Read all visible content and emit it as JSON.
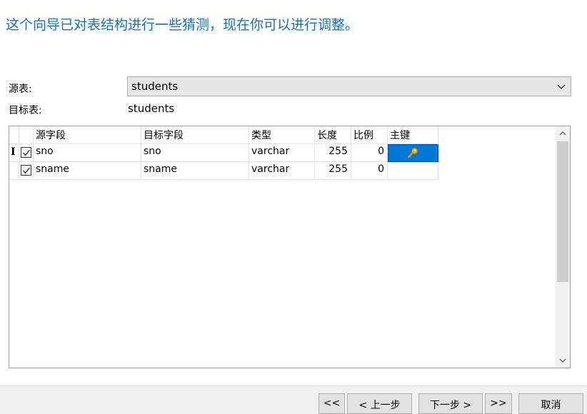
{
  "wizard": {
    "message": "这个向导已对表结构进行一些猜测，现在你可以进行调整。",
    "source_label": "源表:",
    "source_value": "students",
    "target_label": "目标表:",
    "target_value": "students"
  },
  "grid": {
    "headers": {
      "source_field": "源字段",
      "target_field": "目标字段",
      "type": "类型",
      "length": "长度",
      "scale": "比例",
      "primary_key": "主键"
    },
    "rows": [
      {
        "checked": true,
        "source": "sno",
        "target": "sno",
        "type": "varchar",
        "length": "255",
        "scale": "0",
        "primary_key": true
      },
      {
        "checked": true,
        "source": "sname",
        "target": "sname",
        "type": "varchar",
        "length": "255",
        "scale": "0",
        "primary_key": false
      }
    ],
    "row_cursor": "I"
  },
  "footer": {
    "first_label": "<<",
    "prev_label": "< 上一步",
    "next_label": "下一步 >",
    "last_label": ">>",
    "cancel_label": "取消"
  },
  "colors": {
    "heading": "#1a6fb5",
    "selection": "#0078d7",
    "key_icon": "#f0b400"
  },
  "icons": {
    "dropdown": "chevron-down-icon",
    "primary_key": "key-icon",
    "checkbox": "checkmark-icon"
  }
}
